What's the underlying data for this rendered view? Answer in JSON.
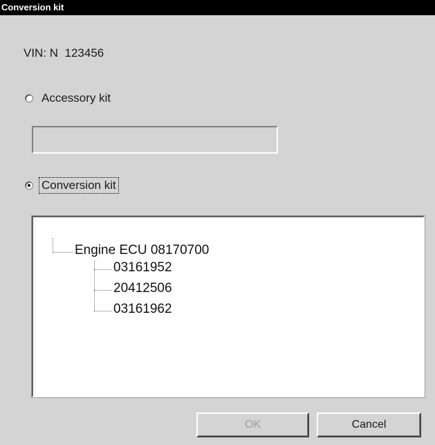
{
  "window": {
    "title": "Conversion kit"
  },
  "vin": {
    "text": "VIN: N  123456"
  },
  "options": {
    "accessory": {
      "label": "Accessory kit",
      "checked": false
    },
    "conversion": {
      "label": "Conversion kit",
      "checked": true
    }
  },
  "accessory_input": {
    "value": ""
  },
  "tree": {
    "root": "Engine ECU 08170700",
    "children": [
      "03161952",
      "20412506",
      "03161962"
    ]
  },
  "buttons": {
    "ok": "OK",
    "cancel": "Cancel",
    "ok_enabled": false
  },
  "colors": {
    "titlebar": "#000000",
    "dialog_bg": "#d4d4d4",
    "disabled_text": "#9c9c9c"
  }
}
